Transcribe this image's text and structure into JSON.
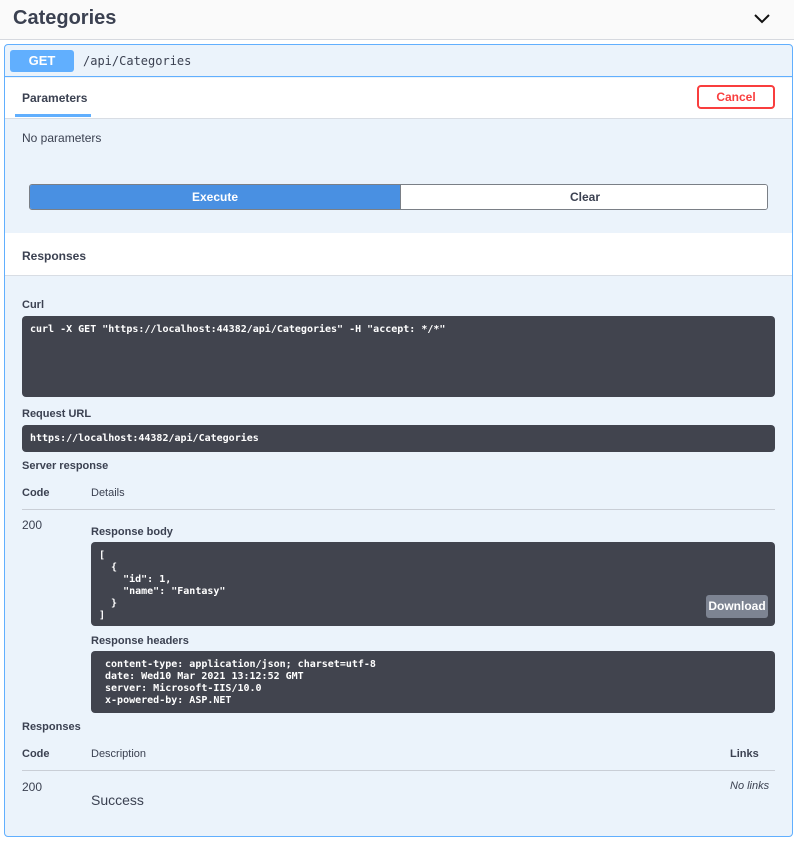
{
  "tag": {
    "title": "Categories"
  },
  "operation": {
    "method": "GET",
    "path": "/api/Categories"
  },
  "parameters": {
    "tab_label": "Parameters",
    "cancel_label": "Cancel",
    "empty_text": "No parameters",
    "execute_label": "Execute",
    "clear_label": "Clear"
  },
  "responses_section": {
    "title": "Responses",
    "curl_label": "Curl",
    "curl_command": "curl -X GET \"https://localhost:44382/api/Categories\" -H \"accept: */*\"",
    "request_url_label": "Request URL",
    "request_url": "https://localhost:44382/api/Categories",
    "server_response_label": "Server response",
    "code_header": "Code",
    "details_header": "Details",
    "status_code": "200",
    "response_body_label": "Response body",
    "response_body": "[\n  {\n    \"id\": 1,\n    \"name\": \"Fantasy\"\n  }\n]",
    "download_label": "Download",
    "response_headers_label": "Response headers",
    "response_headers": " content-type: application/json; charset=utf-8\n date: Wed10 Mar 2021 13:12:52 GMT\n server: Microsoft-IIS/10.0\n x-powered-by: ASP.NET"
  },
  "responses_table": {
    "title": "Responses",
    "code_header": "Code",
    "description_header": "Description",
    "links_header": "Links",
    "rows": [
      {
        "code": "200",
        "description": "Success",
        "links": "No links"
      }
    ]
  }
}
